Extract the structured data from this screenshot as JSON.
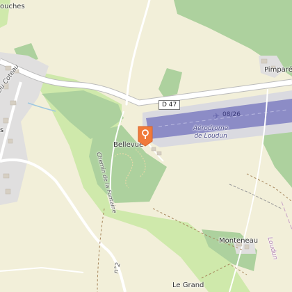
{
  "map": {
    "places": {
      "bellevue": "Bellevue",
      "pimpare": "Pimparé",
      "monteneau": "Monteneau",
      "le_grand": "Le Grand",
      "bouches": "ouches",
      "s_edge": "s"
    },
    "roads": {
      "d47_shield": "D 47",
      "coteau": "Du Coteau",
      "chemin_fontaine": "Chemin de la Fontaine",
      "loudun_road": "Loudun",
      "d_bottom": "n°2"
    },
    "aerodrome": {
      "name_line1": "Aérodrome",
      "name_line2": "de Loudun",
      "runway": "08/26",
      "icon": "airplane-icon"
    },
    "marker": {
      "icon": "map-pin-icon",
      "color": "#f07a3a"
    },
    "colors": {
      "land": "#f2efd9",
      "wood": "#add19e",
      "meadow": "#cfe9ab",
      "runway": "#8c8cc6",
      "apron": "#dadae0",
      "road": "#ffffff",
      "residential": "#e0dfdf"
    }
  }
}
